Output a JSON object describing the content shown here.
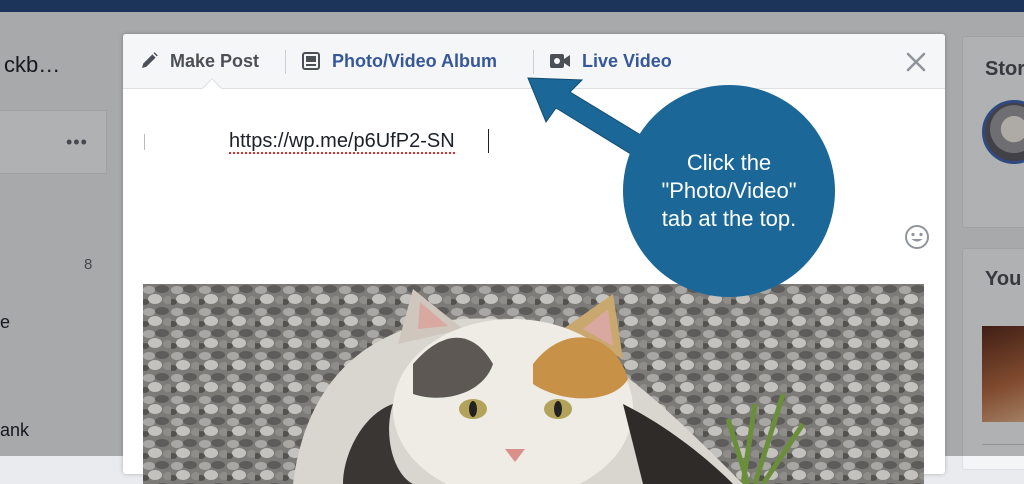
{
  "background": {
    "left_title": "ckb…",
    "left_menu_glyph": "•••",
    "left_count": "8",
    "left_snippet_1": "e",
    "left_snippet_2": "ank",
    "right_card_1_title": "Stor",
    "right_card_2_title": "You"
  },
  "composer": {
    "tabs": [
      {
        "label": "Make Post",
        "icon": "pencil-icon"
      },
      {
        "label": "Photo/Video Album",
        "icon": "photo-album-icon"
      },
      {
        "label": "Live Video",
        "icon": "video-camera-icon"
      }
    ],
    "close_icon": "close-icon",
    "post_text": "https://wp.me/p6UfP2-SN",
    "emoji_icon": "smiley-icon",
    "attached_image": "calico-cat-on-gravel-photo"
  },
  "callout": {
    "text": "Click the \"Photo/Video\" tab at the top.",
    "color": "#1b6898"
  },
  "colors": {
    "top_bar": "#29487d",
    "link_blue": "#365899"
  }
}
